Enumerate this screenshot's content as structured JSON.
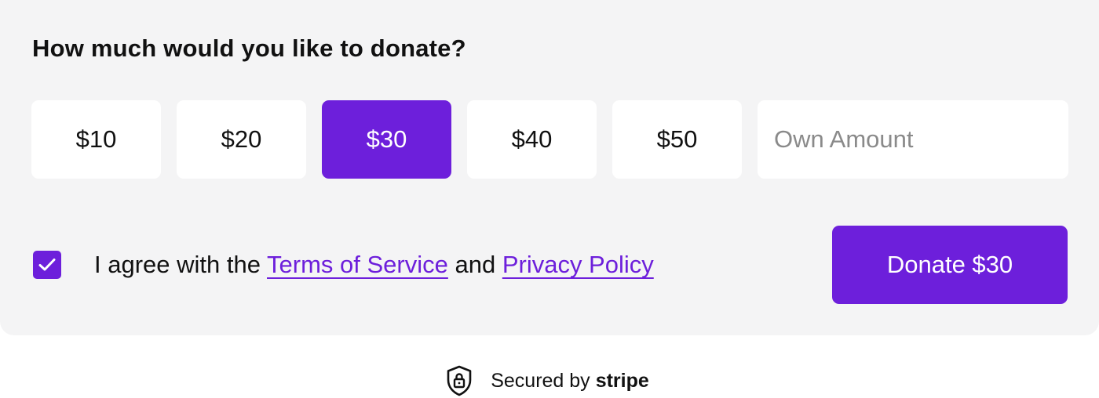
{
  "form": {
    "question": "How much would you like to donate?",
    "amounts": [
      {
        "label": "$10",
        "selected": false
      },
      {
        "label": "$20",
        "selected": false
      },
      {
        "label": "$30",
        "selected": true
      },
      {
        "label": "$40",
        "selected": false
      },
      {
        "label": "$50",
        "selected": false
      }
    ],
    "own_amount": {
      "value": "",
      "placeholder": "Own Amount"
    },
    "agree": {
      "checked": true,
      "text_prefix": "I agree with the ",
      "terms_link": "Terms of Service",
      "text_middle": " and ",
      "privacy_link": "Privacy Policy"
    },
    "donate_button": "Donate $30"
  },
  "footer": {
    "secured_text": "Secured by",
    "brand": "stripe",
    "icon": "shield-lock-icon"
  },
  "colors": {
    "accent": "#6d1fdb",
    "card_background": "#f4f4f5",
    "placeholder": "#8a8a8a"
  }
}
